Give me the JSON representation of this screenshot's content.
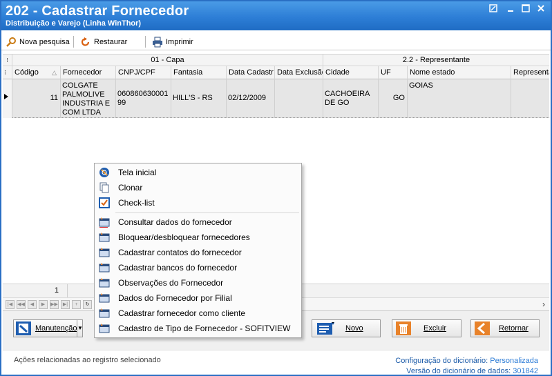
{
  "window": {
    "title": "202 - Cadastrar  Fornecedor",
    "subtitle": "Distribuição e Varejo (Linha WinThor)"
  },
  "toolbar": {
    "nova_pesquisa": "Nova pesquisa",
    "restaurar": "Restaurar",
    "imprimir": "Imprimir"
  },
  "grid": {
    "bands": [
      "01 - Capa",
      "2.2 - Representante"
    ],
    "columns": [
      "Código",
      "Fornecedor",
      "CNPJ/CPF",
      "Fantasia",
      "Data Cadastr",
      "Data Exclusão",
      "Cidade",
      "UF",
      "Nome estado",
      "Representa"
    ],
    "row": {
      "codigo": "11",
      "fornecedor": "COLGATE PALMOLIVE INDUSTRIA E COM LTDA",
      "cnpj": "060860630001 99",
      "fantasia": "HILL'S - RS",
      "data_cadastro": "02/12/2009",
      "data_exclusao": "",
      "cidade": "CACHOEIRA DE GO",
      "uf": "GO",
      "nome_estado": "GOIAS",
      "representante": ""
    },
    "footer_count": "1"
  },
  "context_menu": {
    "items": [
      {
        "label": "Tela inicial",
        "icon": "home-icon"
      },
      {
        "label": "Clonar",
        "icon": "clone-icon"
      },
      {
        "label": "Check-list",
        "icon": "checklist-icon"
      },
      {
        "label": "Consultar dados do fornecedor",
        "icon": "window-icon"
      },
      {
        "label": "Bloquear/desbloquear fornecedores",
        "icon": "window-icon"
      },
      {
        "label": "Cadastrar contatos do fornecedor",
        "icon": "window-icon"
      },
      {
        "label": "Cadastrar bancos do fornecedor",
        "icon": "window-icon"
      },
      {
        "label": "Observações do Fornecedor",
        "icon": "window-icon"
      },
      {
        "label": "Dados do Fornecedor por Filial",
        "icon": "window-icon"
      },
      {
        "label": "Cadastrar fornecedor como cliente",
        "icon": "window-icon"
      },
      {
        "label": "Cadastro de Tipo de Fornecedor - SOFITVIEW",
        "icon": "window-icon"
      }
    ]
  },
  "buttons": {
    "manutencao": "Manutenção",
    "novo": "Novo",
    "excluir": "Excluir",
    "retornar": "Retornar"
  },
  "status": {
    "left": "Ações relacionadas ao registro selecionado",
    "config_label": "Configuração do dicionário:",
    "config_value": "Personalizada",
    "version_label": "Versão do dicionário de dados:",
    "version_value": "301842"
  },
  "colors": {
    "title_bar": "#2d7ed6",
    "link_blue": "#1a5aa8",
    "accent_orange": "#e8822a"
  }
}
